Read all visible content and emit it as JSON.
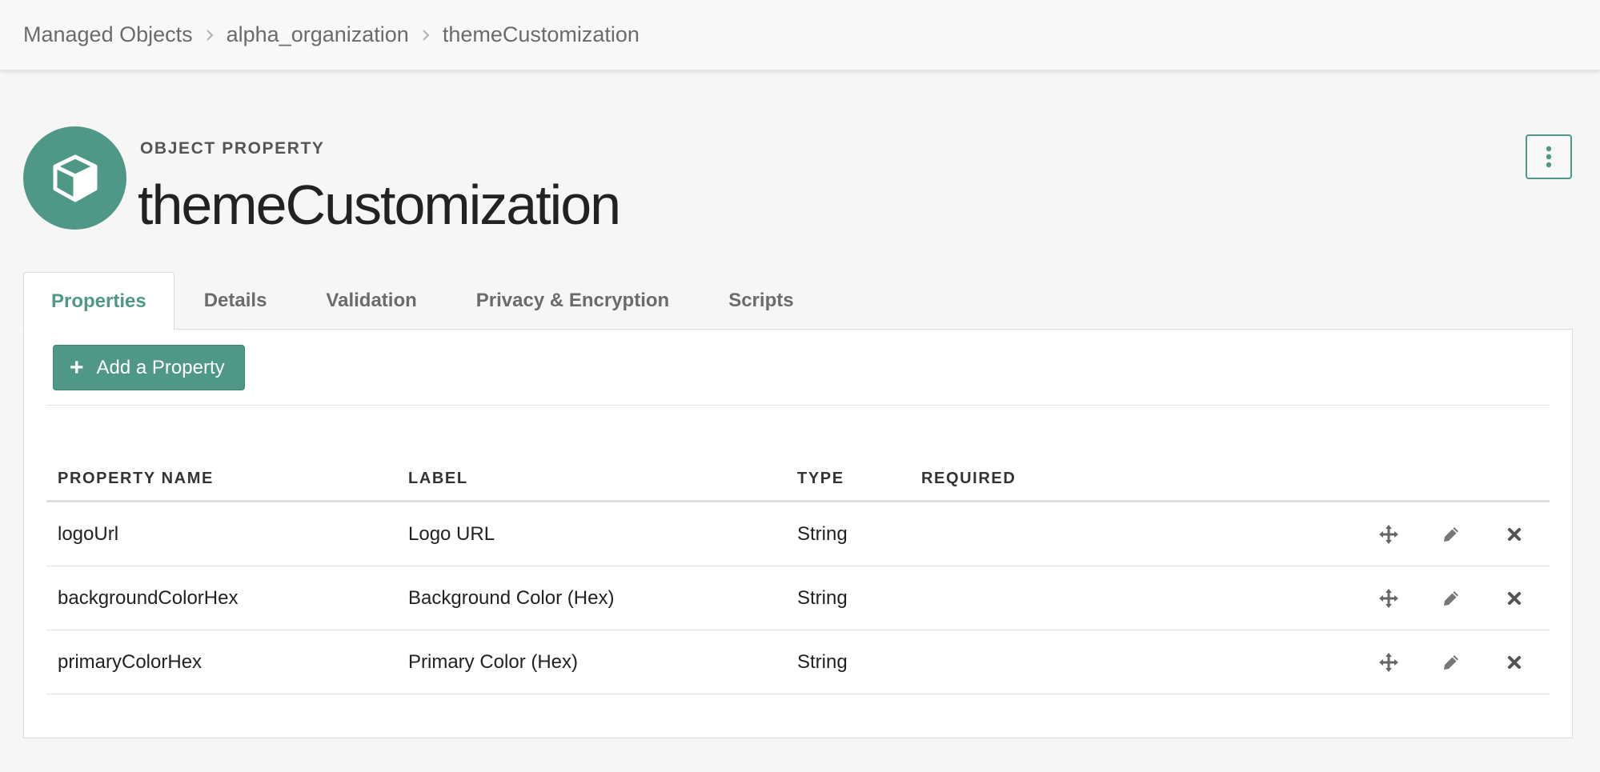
{
  "breadcrumb": [
    "Managed Objects",
    "alpha_organization",
    "themeCustomization"
  ],
  "header": {
    "subtitle": "OBJECT PROPERTY",
    "title": "themeCustomization",
    "icon": "cube-icon"
  },
  "tabs": [
    {
      "label": "Properties",
      "active": true
    },
    {
      "label": "Details",
      "active": false
    },
    {
      "label": "Validation",
      "active": false
    },
    {
      "label": "Privacy & Encryption",
      "active": false
    },
    {
      "label": "Scripts",
      "active": false
    }
  ],
  "add_button": {
    "label": "Add a Property"
  },
  "table": {
    "columns": [
      "PROPERTY NAME",
      "LABEL",
      "TYPE",
      "REQUIRED"
    ],
    "rows": [
      {
        "name": "logoUrl",
        "label": "Logo URL",
        "type": "String",
        "required": ""
      },
      {
        "name": "backgroundColorHex",
        "label": "Background Color (Hex)",
        "type": "String",
        "required": ""
      },
      {
        "name": "primaryColorHex",
        "label": "Primary Color (Hex)",
        "type": "String",
        "required": ""
      }
    ],
    "row_actions": [
      "move-icon",
      "edit-pencil-icon",
      "delete-x-icon"
    ]
  },
  "colors": {
    "accent": "#4f9887",
    "background": "#f6f6f6",
    "text": "#222222",
    "muted": "#6b6b6b"
  }
}
